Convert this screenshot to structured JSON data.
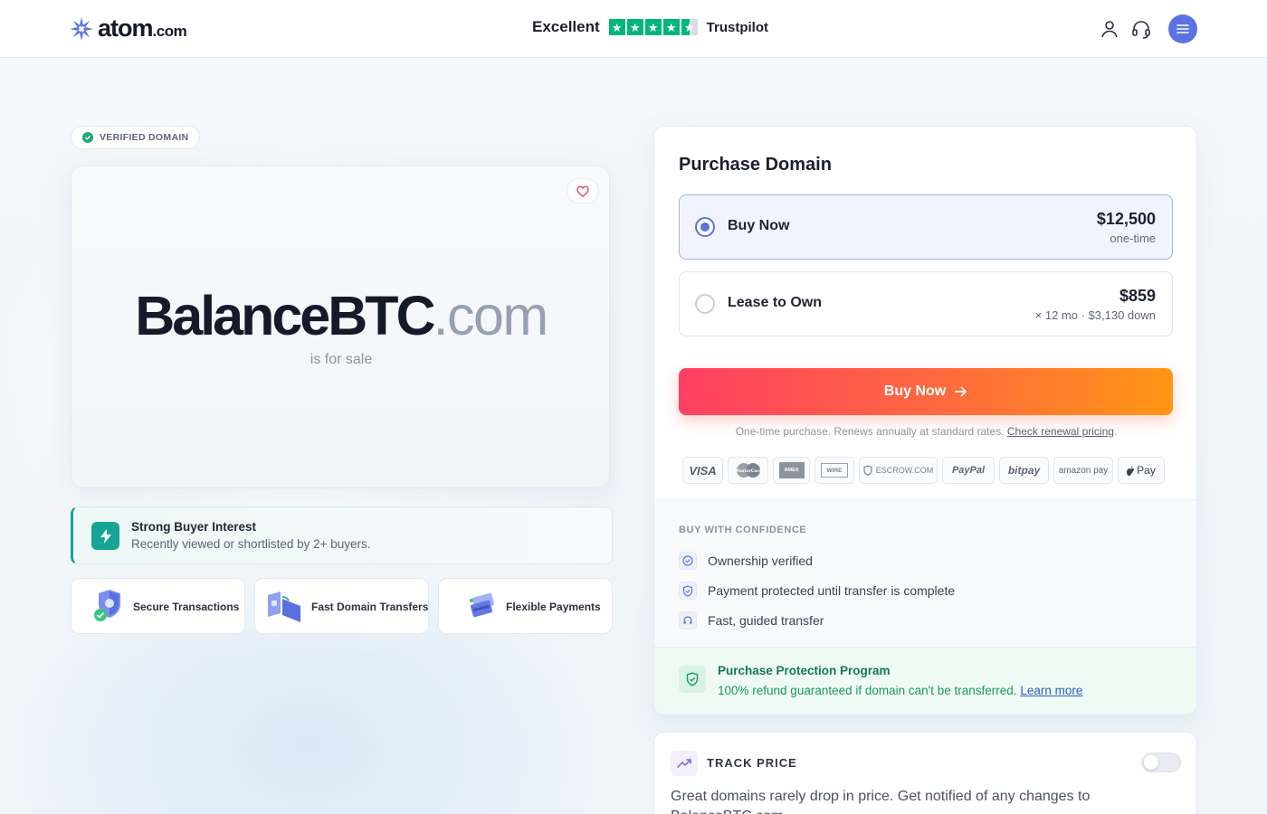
{
  "header": {
    "logo_name": "atom",
    "logo_tld": ".com",
    "trustpilot_rating": "Excellent",
    "trustpilot_name": "Trustpilot",
    "trustpilot_stars": 4.5
  },
  "domain": {
    "verified_badge": "VERIFIED DOMAIN",
    "name": "BalanceBTC",
    "tld": ".com",
    "status": "is for sale"
  },
  "interest": {
    "title": "Strong Buyer Interest",
    "subtitle": "Recently viewed or shortlisted by 2+ buyers."
  },
  "features": [
    {
      "label": "Secure Transactions"
    },
    {
      "label": "Fast Domain Transfers"
    },
    {
      "label": "Flexible Payments"
    }
  ],
  "purchase": {
    "title": "Purchase Domain",
    "options": [
      {
        "label": "Buy Now",
        "price": "$12,500",
        "sub": "one-time",
        "selected": true
      },
      {
        "label": "Lease to Own",
        "price": "$859",
        "sub": "× 12 mo · $3,130 down",
        "selected": false
      }
    ],
    "cta_label": "Buy Now",
    "note_text": "One-time purchase. Renews annually at standard rates.",
    "note_link": "Check renewal pricing",
    "payment_methods": [
      "VISA",
      "MasterCard",
      "AMEX",
      "WIRE",
      "ESCROW.COM",
      "PayPal",
      "bitpay",
      "amazon pay",
      "Pay"
    ]
  },
  "confidence": {
    "title": "BUY WITH CONFIDENCE",
    "items": [
      {
        "label": "Ownership verified",
        "icon": "check-circle-icon"
      },
      {
        "label": "Payment protected until transfer is complete",
        "icon": "shield-icon"
      },
      {
        "label": "Fast, guided transfer",
        "icon": "headset-icon"
      }
    ]
  },
  "protection": {
    "title": "Purchase Protection Program",
    "text": "100% refund guaranteed if domain can't be transferred.",
    "link": "Learn more"
  },
  "track": {
    "title": "TRACK PRICE",
    "text": "Great domains rarely drop in price. Get notified of any changes to BalanceBTC.com",
    "enabled": false
  },
  "colors": {
    "accent": "#5b73df",
    "cta_start": "#ff3f63",
    "cta_end": "#ff9614",
    "success": "#1a9a5c",
    "teal": "#17a496"
  }
}
